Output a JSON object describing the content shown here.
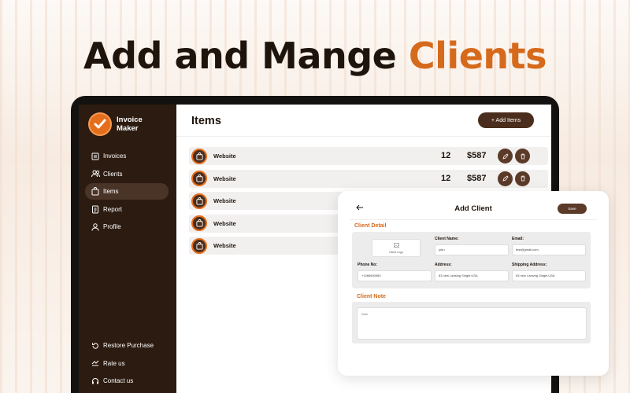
{
  "headline": {
    "prefix": "Add and Mange ",
    "accent": "Clients"
  },
  "colors": {
    "accent": "#d66a1c",
    "sidebar": "#2c1b10",
    "button": "#4a2d1c"
  },
  "app": {
    "name": "Invoice Maker"
  },
  "sidebar": {
    "items": [
      {
        "label": "Invoices",
        "icon": "invoice-icon"
      },
      {
        "label": "Clients",
        "icon": "clients-icon"
      },
      {
        "label": "Items",
        "icon": "bag-icon",
        "active": true
      },
      {
        "label": "Report",
        "icon": "report-icon"
      },
      {
        "label": "Profile",
        "icon": "profile-icon"
      }
    ],
    "bottom": [
      {
        "label": "Restore Purchase",
        "icon": "restore-icon"
      },
      {
        "label": "Rate us",
        "icon": "rate-icon"
      },
      {
        "label": "Contact us",
        "icon": "contact-icon"
      }
    ]
  },
  "items_page": {
    "title": "Items",
    "add_button": "+ Add Items",
    "rows": [
      {
        "name": "Website",
        "qty": "12",
        "price": "$587"
      },
      {
        "name": "Website",
        "qty": "12",
        "price": "$587"
      },
      {
        "name": "Website"
      },
      {
        "name": "Website"
      },
      {
        "name": "Website"
      }
    ]
  },
  "add_client": {
    "title": "Add Client",
    "save": "Save",
    "client_detail": "Client Detail",
    "logo_label": "Client Logo",
    "fields": {
      "client_name": {
        "label": "Client Name:",
        "value": "john"
      },
      "email": {
        "label": "Email:",
        "value": "test@gmail.com"
      },
      "phone": {
        "label": "Phone No:",
        "value": "+1466600980"
      },
      "address": {
        "label": "Address:",
        "value": "83 new Lansing Single,USA"
      },
      "shipping": {
        "label": "Shipping Address:",
        "value": "83 new Lansing Single,USA"
      }
    },
    "client_note": "Client Note",
    "note_placeholder": "Note"
  }
}
